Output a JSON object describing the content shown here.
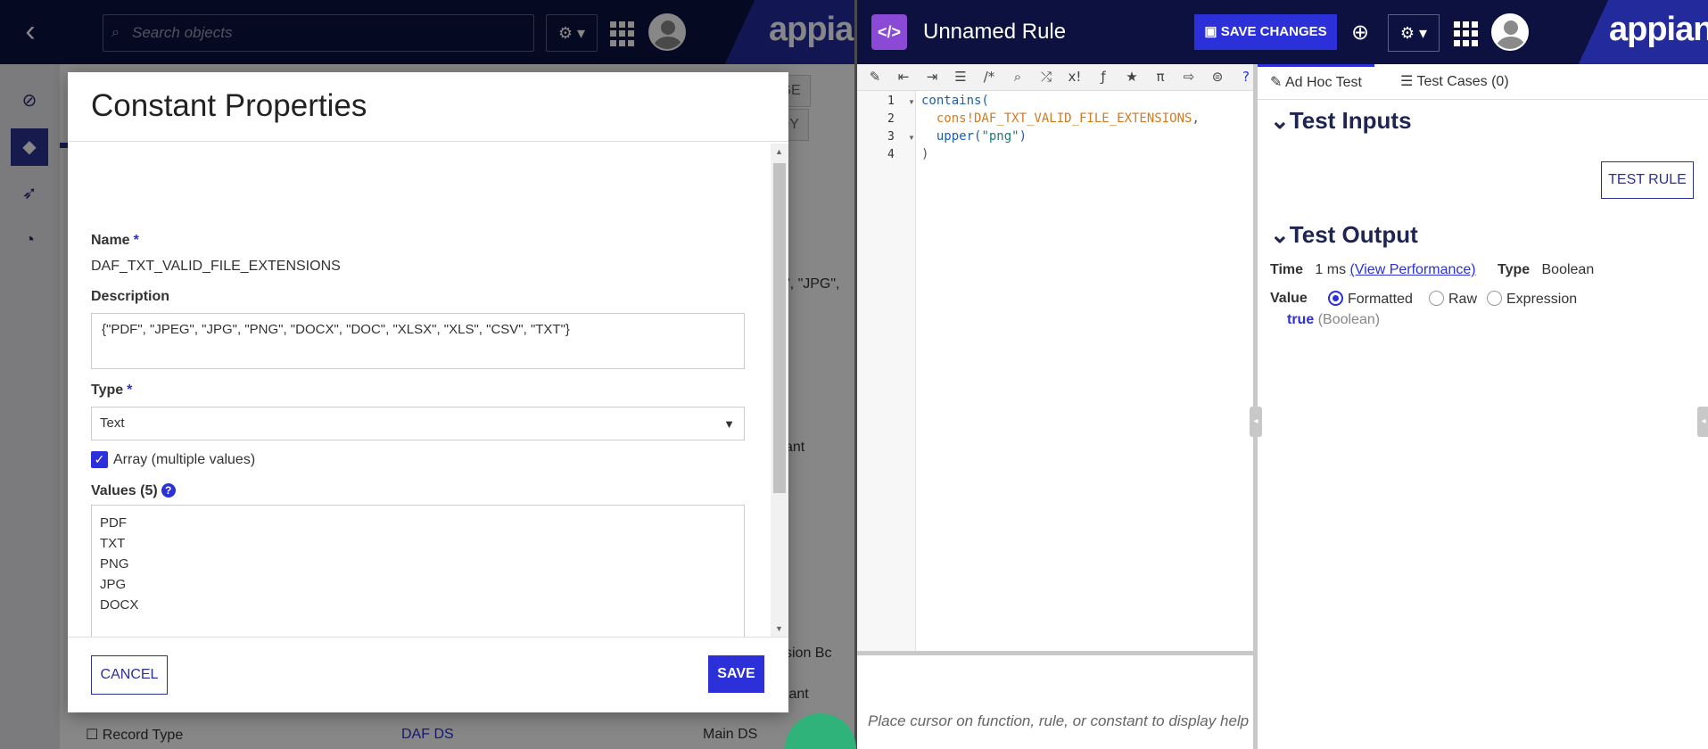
{
  "left_window": {
    "search_placeholder": "Search objects",
    "brand": "appian",
    "background": {
      "package_btn": "ACKAGE",
      "deploy_btn": "DEPLOY",
      "value_snippet": "\", \"JPG\",",
      "row_text_1": "ant",
      "row_text_2": "sion Bc",
      "row_text_3": "tant",
      "record_type": "Record Type",
      "ds_name": "DAF DS",
      "ds_desc": "Main DS"
    }
  },
  "modal": {
    "title": "Constant Properties",
    "name_label": "Name",
    "name_value": "DAF_TXT_VALID_FILE_EXTENSIONS",
    "description_label": "Description",
    "description_value": "{\"PDF\", \"JPEG\", \"JPG\", \"PNG\", \"DOCX\", \"DOC\", \"XLSX\", \"XLS\", \"CSV\", \"TXT\"}",
    "type_label": "Type",
    "type_value": "Text",
    "array_label": "Array (multiple values)",
    "array_checked": true,
    "values_label": "Values (5)",
    "values": [
      "PDF",
      "TXT",
      "PNG",
      "JPG",
      "DOCX"
    ],
    "cancel_label": "CANCEL",
    "save_label": "SAVE"
  },
  "right_window": {
    "title": "Unnamed Rule",
    "save_changes_label": "SAVE CHANGES",
    "brand": "appian",
    "line_numbers": [
      "1",
      "2",
      "3",
      "4"
    ],
    "code": {
      "l1_fn": "contains(",
      "l2_const": "cons!DAF_TXT_VALID_FILE_EXTENSIONS",
      "l2_comma": ",",
      "l3_fn": "upper(",
      "l3_str": "\"png\"",
      "l3_close": ")",
      "l4": ")"
    },
    "help_text": "Place cursor on function, rule, or constant to display help",
    "tabs": [
      "Ad Hoc Test",
      "Test Cases (0)"
    ],
    "test_inputs_heading": "Test Inputs",
    "test_rule_label": "TEST RULE",
    "test_output_heading": "Test Output",
    "time_label": "Time",
    "time_value": "1 ms",
    "view_performance": "(View Performance)",
    "type_label": "Type",
    "type_value": "Boolean",
    "value_label": "Value",
    "value_options": [
      "Formatted",
      "Raw",
      "Expression"
    ],
    "value_selected": "Formatted",
    "result_value": "true",
    "result_type": "(Boolean)"
  },
  "colors": {
    "header_bg": "#0c1140",
    "accent": "#2b30d8",
    "rule_icon": "#8b4ad6"
  }
}
